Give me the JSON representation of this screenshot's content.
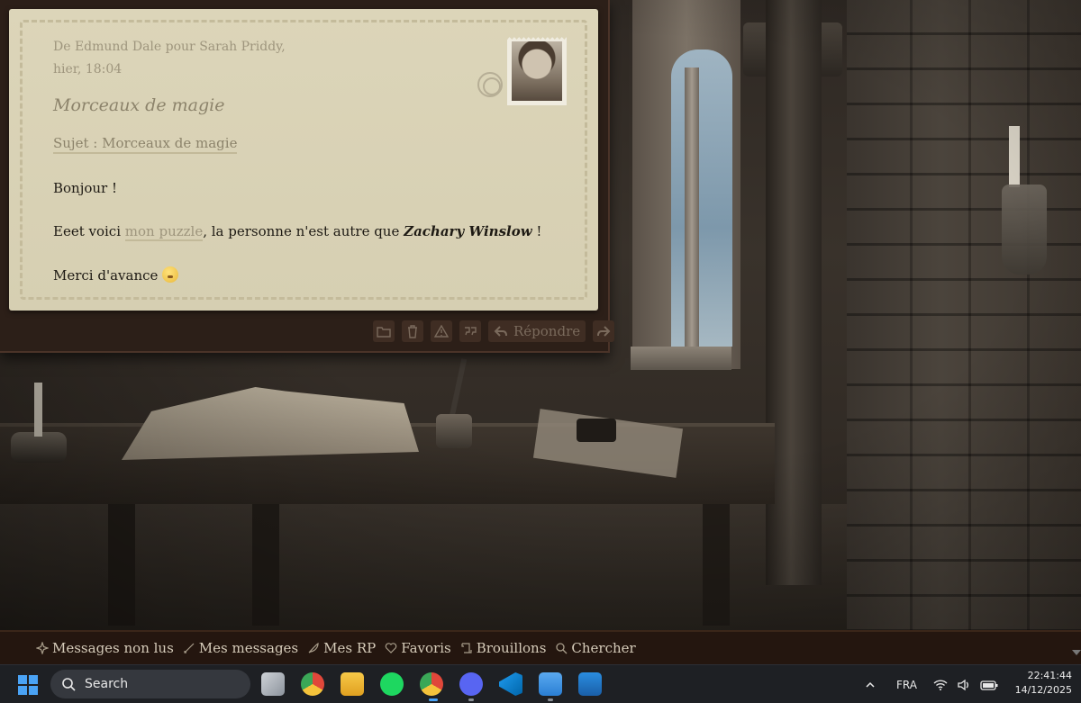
{
  "letter": {
    "from_line": "De Edmund Dale pour Sarah Priddy,",
    "date": "hier, 18:04",
    "title": "Morceaux de magie",
    "subject": "Sujet : Morceaux de magie",
    "greeting": "Bonjour !",
    "line2_prefix": "Eeet voici ",
    "line2_link": "mon puzzle",
    "line2_middle": ", la personne n'est autre que ",
    "line2_name": "Zachary Winslow",
    "line2_suffix": " !",
    "line3": "Merci d'avance "
  },
  "actions": {
    "reply_label": "Répondre"
  },
  "forum_nav": [
    {
      "label": "Messages non lus",
      "icon": "sparkle-icon"
    },
    {
      "label": "Mes messages",
      "icon": "quill-icon"
    },
    {
      "label": "Mes RP",
      "icon": "feather-icon"
    },
    {
      "label": "Favoris",
      "icon": "heart-icon"
    },
    {
      "label": "Brouillons",
      "icon": "scroll-icon"
    },
    {
      "label": "Chercher",
      "icon": "search-icon"
    }
  ],
  "taskbar": {
    "search_placeholder": "Search",
    "language": "FRA",
    "time": "22:41:44",
    "date": "14/12/2025"
  },
  "colors": {
    "letter_paper": "#d8d1b4",
    "panel_frame": "#2c1f18",
    "forum_bar": "#24160f",
    "taskbar": "#1e2024"
  }
}
